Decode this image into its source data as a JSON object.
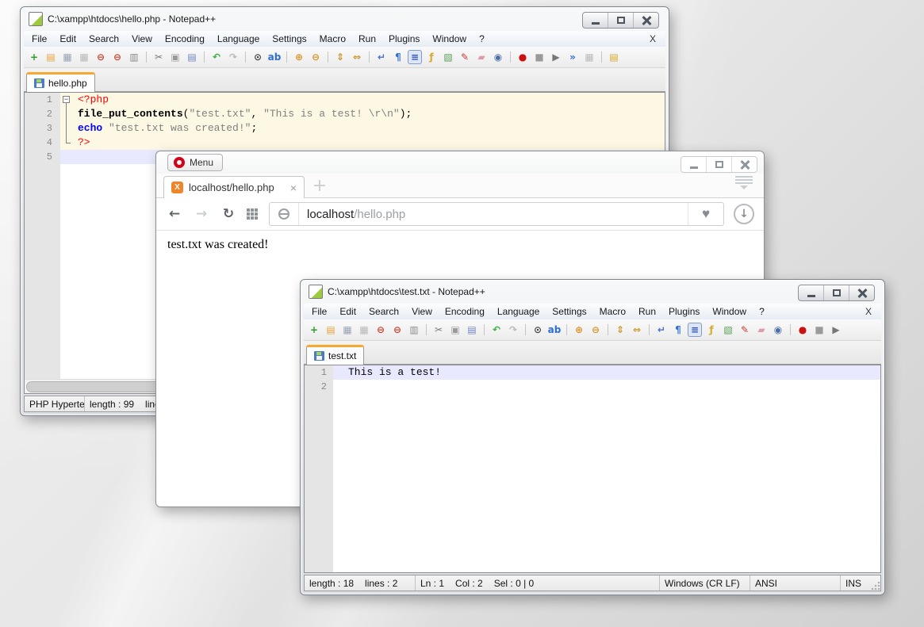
{
  "colors": {
    "tab_accent_orange": "#f7a833",
    "php_block_bg": "#fdf8e3",
    "current_line_bg": "#e8e8ff",
    "opera_logo_red": "#d0021b",
    "xampp_orange": "#f0862a"
  },
  "npp_hello": {
    "title": "C:\\xampp\\htdocs\\hello.php - Notepad++",
    "menu": [
      "File",
      "Edit",
      "Search",
      "View",
      "Encoding",
      "Language",
      "Settings",
      "Macro",
      "Run",
      "Plugins",
      "Window",
      "?"
    ],
    "menu_close": "X",
    "toolbar": [
      {
        "name": "new-file-icon",
        "glyph": "+",
        "color": "#2f9e2f"
      },
      {
        "name": "open-folder-icon",
        "glyph": "▤",
        "color": "#e8a33d"
      },
      {
        "name": "save-icon",
        "glyph": "▦",
        "color": "#9aa3b4"
      },
      {
        "name": "save-all-icon",
        "glyph": "▦",
        "color": "#b8b8b8"
      },
      {
        "name": "close-doc-icon",
        "glyph": "⊖",
        "color": "#cc4433"
      },
      {
        "name": "close-all-docs-icon",
        "glyph": "⊖",
        "color": "#cc4433"
      },
      {
        "name": "print-icon",
        "glyph": "▥",
        "color": "#8a8a8a"
      },
      {
        "name": "cut-icon",
        "glyph": "✂",
        "color": "#7a7a7a",
        "sep": true
      },
      {
        "name": "copy-icon",
        "glyph": "▣",
        "color": "#9a9a9a"
      },
      {
        "name": "paste-icon",
        "glyph": "▤",
        "color": "#6f86c2"
      },
      {
        "name": "undo-icon",
        "glyph": "↶",
        "color": "#3fae49",
        "sep": true
      },
      {
        "name": "redo-icon",
        "glyph": "↷",
        "color": "#b9b9b9"
      },
      {
        "name": "find-icon",
        "glyph": "⊙",
        "color": "#444444",
        "sep": true
      },
      {
        "name": "replace-icon",
        "glyph": "ab",
        "color": "#2f6fd0"
      },
      {
        "name": "zoom-in-icon",
        "glyph": "⊕",
        "color": "#d9952b",
        "sep": true
      },
      {
        "name": "zoom-out-icon",
        "glyph": "⊖",
        "color": "#d9952b"
      },
      {
        "name": "sync-vertical-scroll-icon",
        "glyph": "⇕",
        "color": "#c79a2f",
        "sep": true
      },
      {
        "name": "sync-horizontal-scroll-icon",
        "glyph": "⇔",
        "color": "#c79a2f"
      },
      {
        "name": "word-wrap-icon",
        "glyph": "↵",
        "color": "#4a6fd0",
        "sep": true
      },
      {
        "name": "show-all-characters-icon",
        "glyph": "¶",
        "color": "#2f6fd0"
      },
      {
        "name": "indent-guide-icon",
        "glyph": "≡",
        "color": "#2f4fd0",
        "pressed": true
      },
      {
        "name": "function-list-icon",
        "glyph": "ƒ",
        "color": "#d9a92b"
      },
      {
        "name": "document-map-icon",
        "glyph": "▧",
        "color": "#58a058"
      },
      {
        "name": "document-switcher-icon",
        "glyph": "✎",
        "color": "#c23a3a"
      },
      {
        "name": "project-panel-icon",
        "glyph": "▰",
        "color": "#df9aaa"
      },
      {
        "name": "file-monitoring-eye-icon",
        "glyph": "◉",
        "color": "#4a6fa5"
      },
      {
        "name": "macro-record-icon",
        "glyph": "●",
        "color": "#cc1111",
        "sep": true
      },
      {
        "name": "macro-stop-icon",
        "glyph": "■",
        "color": "#9a9a9a"
      },
      {
        "name": "macro-play-icon",
        "glyph": "▶",
        "color": "#777777"
      },
      {
        "name": "macro-run-multiple-icon",
        "glyph": "»",
        "color": "#2f6fd0"
      },
      {
        "name": "macro-save-icon",
        "glyph": "▦",
        "color": "#bbbbbb"
      },
      {
        "name": "open-containing-folder-icon",
        "glyph": "▤",
        "color": "#d9a92b",
        "sep": true
      }
    ],
    "tab": {
      "label": "hello.php"
    },
    "editor": {
      "lines": [
        {
          "num": "1",
          "fold": "open",
          "bg": "php",
          "segments": [
            {
              "t": "<?php",
              "c": "phptag"
            }
          ]
        },
        {
          "num": "2",
          "fold": "line",
          "bg": "php",
          "segments": [
            {
              "t": "file_put_contents",
              "c": "func"
            },
            {
              "t": "(",
              "c": "op"
            },
            {
              "t": "\"test.txt\"",
              "c": "str"
            },
            {
              "t": ", ",
              "c": "op"
            },
            {
              "t": "\"This is a test! \\r\\n\"",
              "c": "str"
            },
            {
              "t": ")",
              "c": "op"
            },
            {
              "t": ";",
              "c": "op"
            }
          ]
        },
        {
          "num": "3",
          "fold": "line",
          "bg": "php",
          "segments": [
            {
              "t": "echo",
              "c": "kw"
            },
            {
              "t": " ",
              "c": "op"
            },
            {
              "t": "\"test.txt was created!\"",
              "c": "str"
            },
            {
              "t": ";",
              "c": "op"
            }
          ]
        },
        {
          "num": "4",
          "fold": "end",
          "bg": "php",
          "segments": [
            {
              "t": "?>",
              "c": "phptag"
            }
          ]
        },
        {
          "num": "5",
          "fold": "",
          "bg": "current",
          "segments": []
        }
      ]
    },
    "status": {
      "doctype": "PHP Hyperte",
      "length": "length : 99",
      "lines": "lines"
    }
  },
  "opera": {
    "menu_label": "Menu",
    "tab": {
      "icon_glyph": "X",
      "label": "localhost/hello.php",
      "close_glyph": "×"
    },
    "newtab_glyph": "+",
    "nav": {
      "back": "←",
      "forward": "→",
      "reload": "↻"
    },
    "address": {
      "host": "localhost",
      "path": "/hello.php"
    },
    "heart_glyph": "♥",
    "download_glyph": "↓",
    "content": "test.txt was created!"
  },
  "npp_test": {
    "title": "C:\\xampp\\htdocs\\test.txt - Notepad++",
    "menu": [
      "File",
      "Edit",
      "Search",
      "View",
      "Encoding",
      "Language",
      "Settings",
      "Macro",
      "Run",
      "Plugins",
      "Window",
      "?"
    ],
    "menu_close": "X",
    "toolbar": [
      {
        "name": "new-file-icon",
        "glyph": "+",
        "color": "#2f9e2f"
      },
      {
        "name": "open-folder-icon",
        "glyph": "▤",
        "color": "#e8a33d"
      },
      {
        "name": "save-icon",
        "glyph": "▦",
        "color": "#9aa3b4"
      },
      {
        "name": "save-all-icon",
        "glyph": "▦",
        "color": "#b8b8b8"
      },
      {
        "name": "close-doc-icon",
        "glyph": "⊖",
        "color": "#cc4433"
      },
      {
        "name": "close-all-docs-icon",
        "glyph": "⊖",
        "color": "#cc4433"
      },
      {
        "name": "print-icon",
        "glyph": "▥",
        "color": "#8a8a8a"
      },
      {
        "name": "cut-icon",
        "glyph": "✂",
        "color": "#7a7a7a",
        "sep": true
      },
      {
        "name": "copy-icon",
        "glyph": "▣",
        "color": "#9a9a9a"
      },
      {
        "name": "paste-icon",
        "glyph": "▤",
        "color": "#6f86c2"
      },
      {
        "name": "undo-icon",
        "glyph": "↶",
        "color": "#3fae49",
        "sep": true
      },
      {
        "name": "redo-icon",
        "glyph": "↷",
        "color": "#b9b9b9"
      },
      {
        "name": "find-icon",
        "glyph": "⊙",
        "color": "#444444",
        "sep": true
      },
      {
        "name": "replace-icon",
        "glyph": "ab",
        "color": "#2f6fd0"
      },
      {
        "name": "zoom-in-icon",
        "glyph": "⊕",
        "color": "#d9952b",
        "sep": true
      },
      {
        "name": "zoom-out-icon",
        "glyph": "⊖",
        "color": "#d9952b"
      },
      {
        "name": "sync-vertical-scroll-icon",
        "glyph": "⇕",
        "color": "#c79a2f",
        "sep": true
      },
      {
        "name": "sync-horizontal-scroll-icon",
        "glyph": "⇔",
        "color": "#c79a2f"
      },
      {
        "name": "word-wrap-icon",
        "glyph": "↵",
        "color": "#4a6fd0",
        "sep": true
      },
      {
        "name": "show-all-characters-icon",
        "glyph": "¶",
        "color": "#2f6fd0"
      },
      {
        "name": "indent-guide-icon",
        "glyph": "≡",
        "color": "#2f4fd0",
        "pressed": true
      },
      {
        "name": "function-list-icon",
        "glyph": "ƒ",
        "color": "#d9a92b"
      },
      {
        "name": "document-map-icon",
        "glyph": "▧",
        "color": "#58a058"
      },
      {
        "name": "document-switcher-icon",
        "glyph": "✎",
        "color": "#c23a3a"
      },
      {
        "name": "project-panel-icon",
        "glyph": "▰",
        "color": "#df9aaa"
      },
      {
        "name": "file-monitoring-eye-icon",
        "glyph": "◉",
        "color": "#4a6fa5"
      },
      {
        "name": "macro-record-icon",
        "glyph": "●",
        "color": "#cc1111",
        "sep": true
      },
      {
        "name": "macro-stop-icon",
        "glyph": "■",
        "color": "#9a9a9a"
      },
      {
        "name": "macro-play-icon",
        "glyph": "▶",
        "color": "#777777"
      }
    ],
    "tab": {
      "label": "test.txt"
    },
    "editor": {
      "lines": [
        {
          "num": "1",
          "fold": "",
          "bg": "current",
          "segments": [
            {
              "t": "This is a test!",
              "c": "plain"
            }
          ]
        },
        {
          "num": "2",
          "fold": "",
          "bg": "",
          "segments": []
        }
      ]
    },
    "status": {
      "length": "length : 18",
      "lines": "lines : 2",
      "ln": "Ln : 1",
      "col": "Col : 2",
      "sel": "Sel : 0 | 0",
      "eol": "Windows (CR LF)",
      "encoding": "ANSI",
      "mode": "INS"
    }
  }
}
